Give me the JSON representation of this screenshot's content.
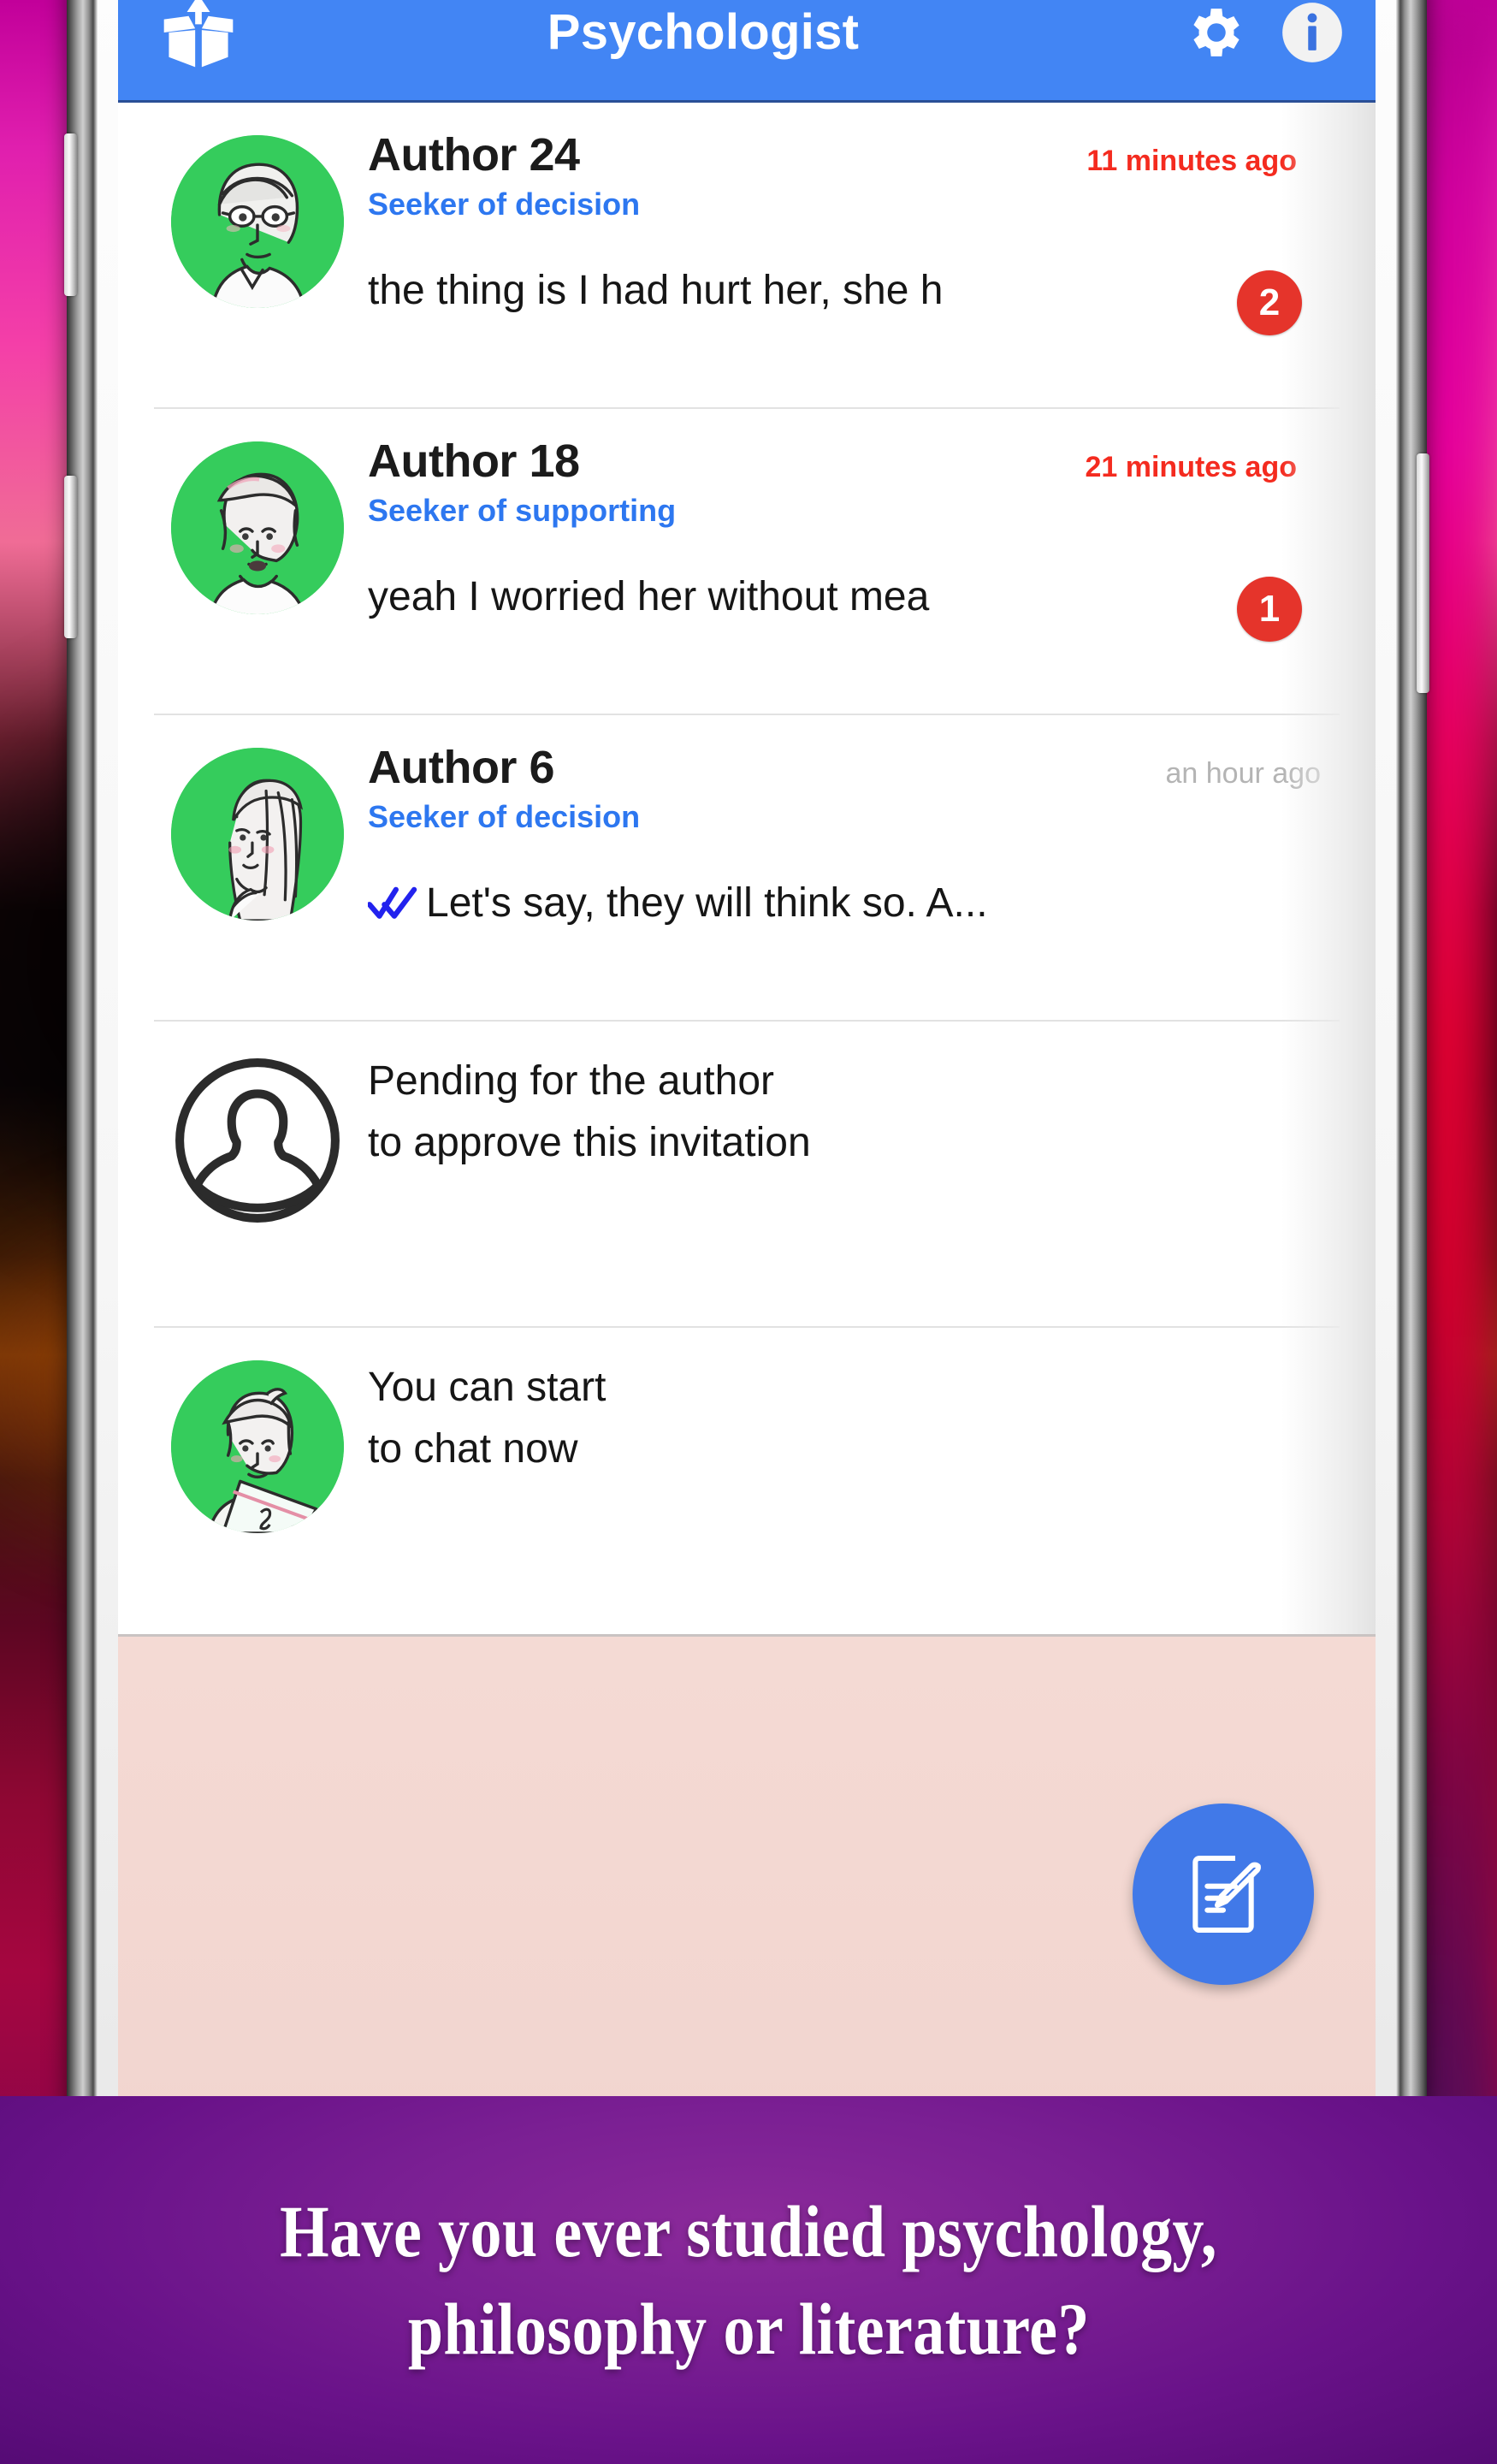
{
  "app": {
    "title": "Psychologist",
    "logo_icon": "open-box-arrow-up-icon",
    "settings_icon": "gear-icon",
    "info_icon": "info-circle-icon",
    "accent_color": "#4285f4",
    "badge_color": "#e5342b",
    "time_color": "#f42b1f",
    "role_color": "#2d77f0",
    "avatar_bg_color": "#35cc5c"
  },
  "conversations": [
    {
      "avatar": "sketch-man-glasses-avatar",
      "author": "Author 24",
      "role": "Seeker of decision",
      "time": "11 minutes ago",
      "time_muted": false,
      "preview": "the thing is I had hurt her, she h",
      "badge": "2",
      "read_ticks": false
    },
    {
      "avatar": "sketch-woman-bandana-avatar",
      "author": "Author 18",
      "role": "Seeker of supporting",
      "time": "21 minutes ago",
      "time_muted": false,
      "preview": "yeah I worried her without mea",
      "badge": "1",
      "read_ticks": false
    },
    {
      "avatar": "sketch-woman-long-hair-avatar",
      "author": "Author 6",
      "role": "Seeker of decision",
      "time": "an hour ago",
      "time_muted": true,
      "preview": "Let's say, they will think so. A...",
      "badge": "",
      "read_ticks": true
    }
  ],
  "status_rows": [
    {
      "avatar": "person-placeholder-icon",
      "line1": "Pending for the author",
      "line2": "to approve this invitation"
    },
    {
      "avatar": "sketch-woman-book-avatar",
      "line1": "You can start",
      "line2": "to chat now"
    }
  ],
  "fab": {
    "icon": "compose-note-pencil-icon",
    "color": "#4179e8"
  },
  "caption": {
    "line1": "Have you ever studied psychology,",
    "line2": "philosophy or literature?"
  }
}
